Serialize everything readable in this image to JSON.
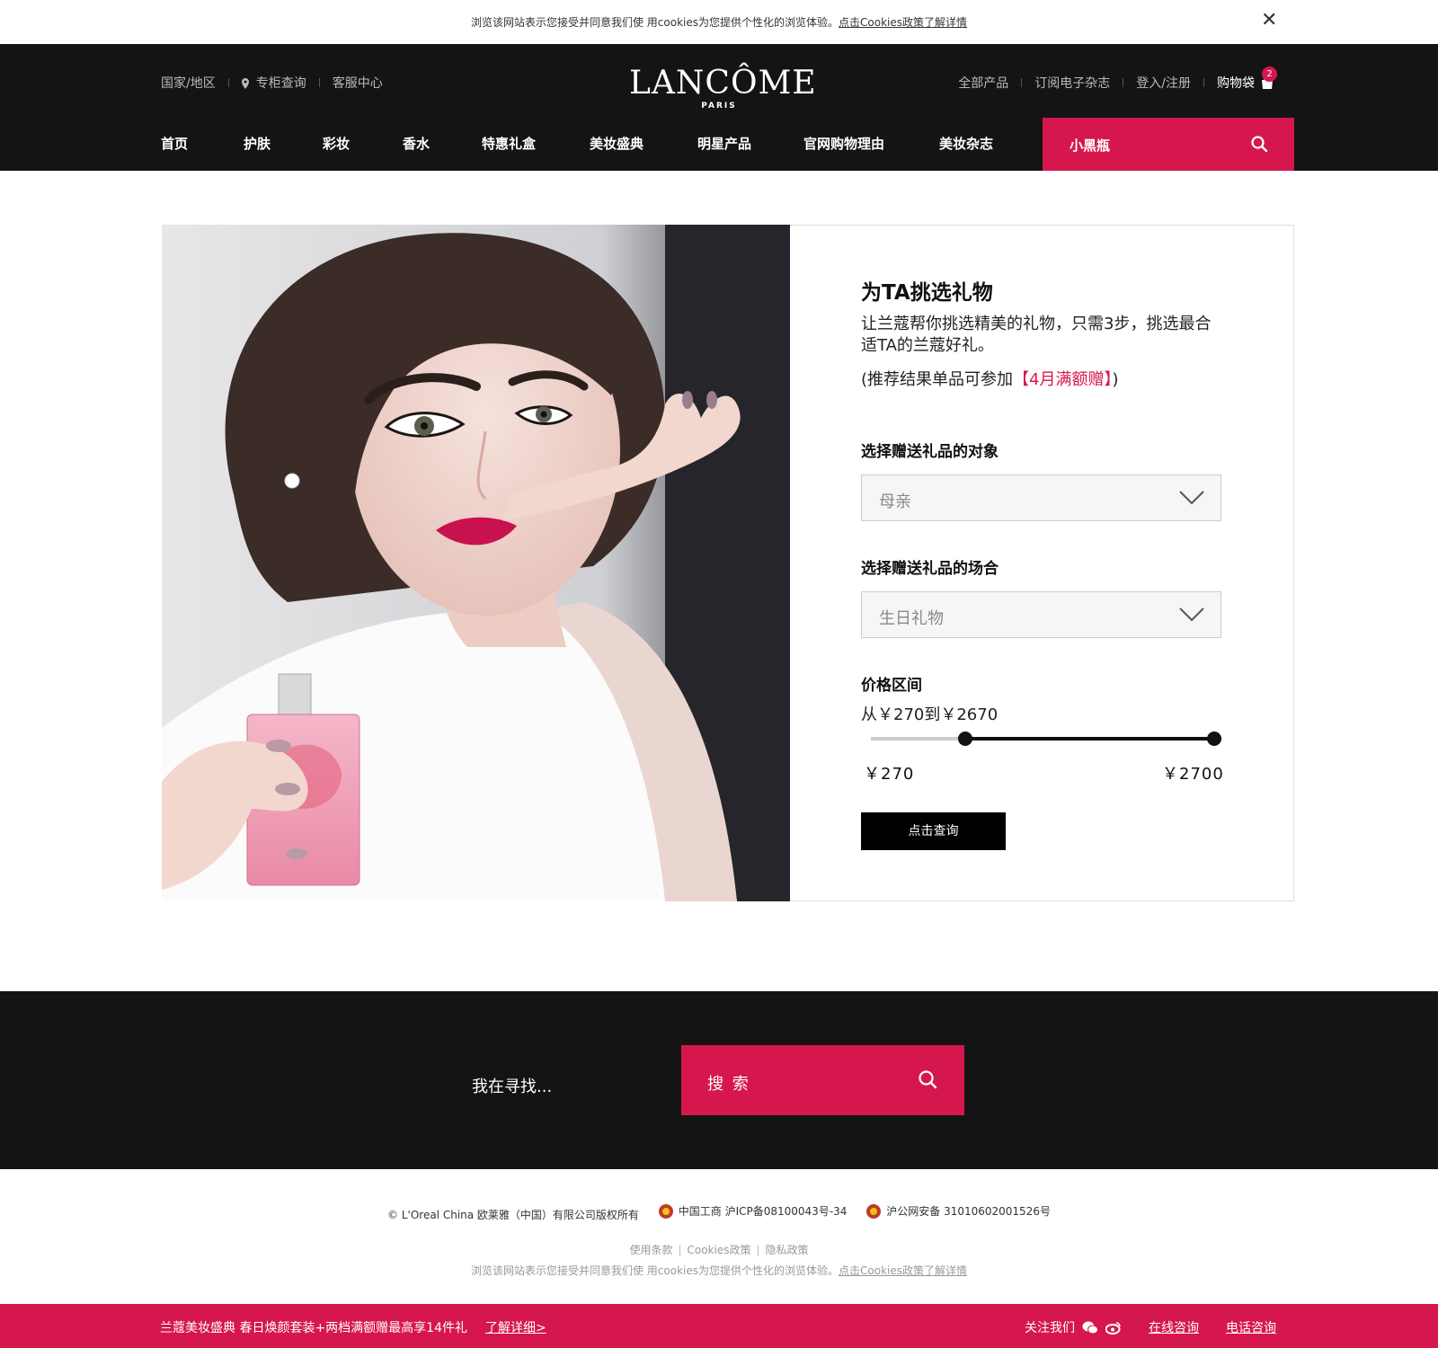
{
  "cookie_bar": {
    "text": "浏览该网站表示您接受并同意我们使 用cookies为您提供个性化的浏览体验。",
    "link": "点击Cookies政策了解详情",
    "close": "✕"
  },
  "header": {
    "util_left": [
      "国家/地区",
      "专柜查询",
      "客服中心"
    ],
    "logo_brand": "LANCÔME",
    "logo_sub": "PARIS",
    "util_right": [
      "全部产品",
      "订阅电子杂志",
      "登入/注册"
    ],
    "cart_label": "购物袋",
    "cart_count": "2",
    "nav": [
      "首页",
      "护肤",
      "彩妆",
      "香水",
      "特惠礼盒",
      "美妆盛典",
      "明星产品",
      "官网购物理由",
      "美妆杂志"
    ],
    "search_placeholder": "小黑瓶"
  },
  "gift_finder": {
    "title": "为TA挑选礼物",
    "desc": "让兰蔻帮你挑选精美的礼物，只需3步，挑选最合适TA的兰蔻好礼。",
    "note_prefix": "(推荐结果单品可参加",
    "note_highlight": "【4月满额赠】",
    "note_suffix": ")",
    "recipient_label": "选择赠送礼品的对象",
    "recipient_value": "母亲",
    "occasion_label": "选择赠送礼品的场合",
    "occasion_value": "生日礼物",
    "price_label": "价格区间",
    "price_range_text": "从￥270到￥2670",
    "slider_min_label": "￥270",
    "slider_max_label": "￥2700",
    "slider_range_low": 270,
    "slider_range_high": 2670,
    "query_button": "点击查询"
  },
  "footer_search": {
    "label": "我在寻找...",
    "placeholder": "搜 索"
  },
  "legal": {
    "copyright": "© L'Oreal China 欧莱雅（中国）有限公司版权所有",
    "icp": "中国工商 沪ICP备08100043号-34",
    "police": "沪公网安备 31010602001526号",
    "links": [
      "使用条款",
      "Cookies政策",
      "隐私政策"
    ],
    "cookie_text": "浏览该网站表示您接受并同意我们使 用cookies为您提供个性化的浏览体验。",
    "cookie_link": "点击Cookies政策了解详情"
  },
  "promo": {
    "text": "兰蔻美妆盛典 春日焕颜套装+两档满额赠最高享14件礼",
    "more": "了解详细>",
    "follow": "关注我们",
    "online": "在线咨询",
    "phone": "电话咨询"
  },
  "colors": {
    "accent": "#d6174d",
    "header_bg": "#141414"
  }
}
